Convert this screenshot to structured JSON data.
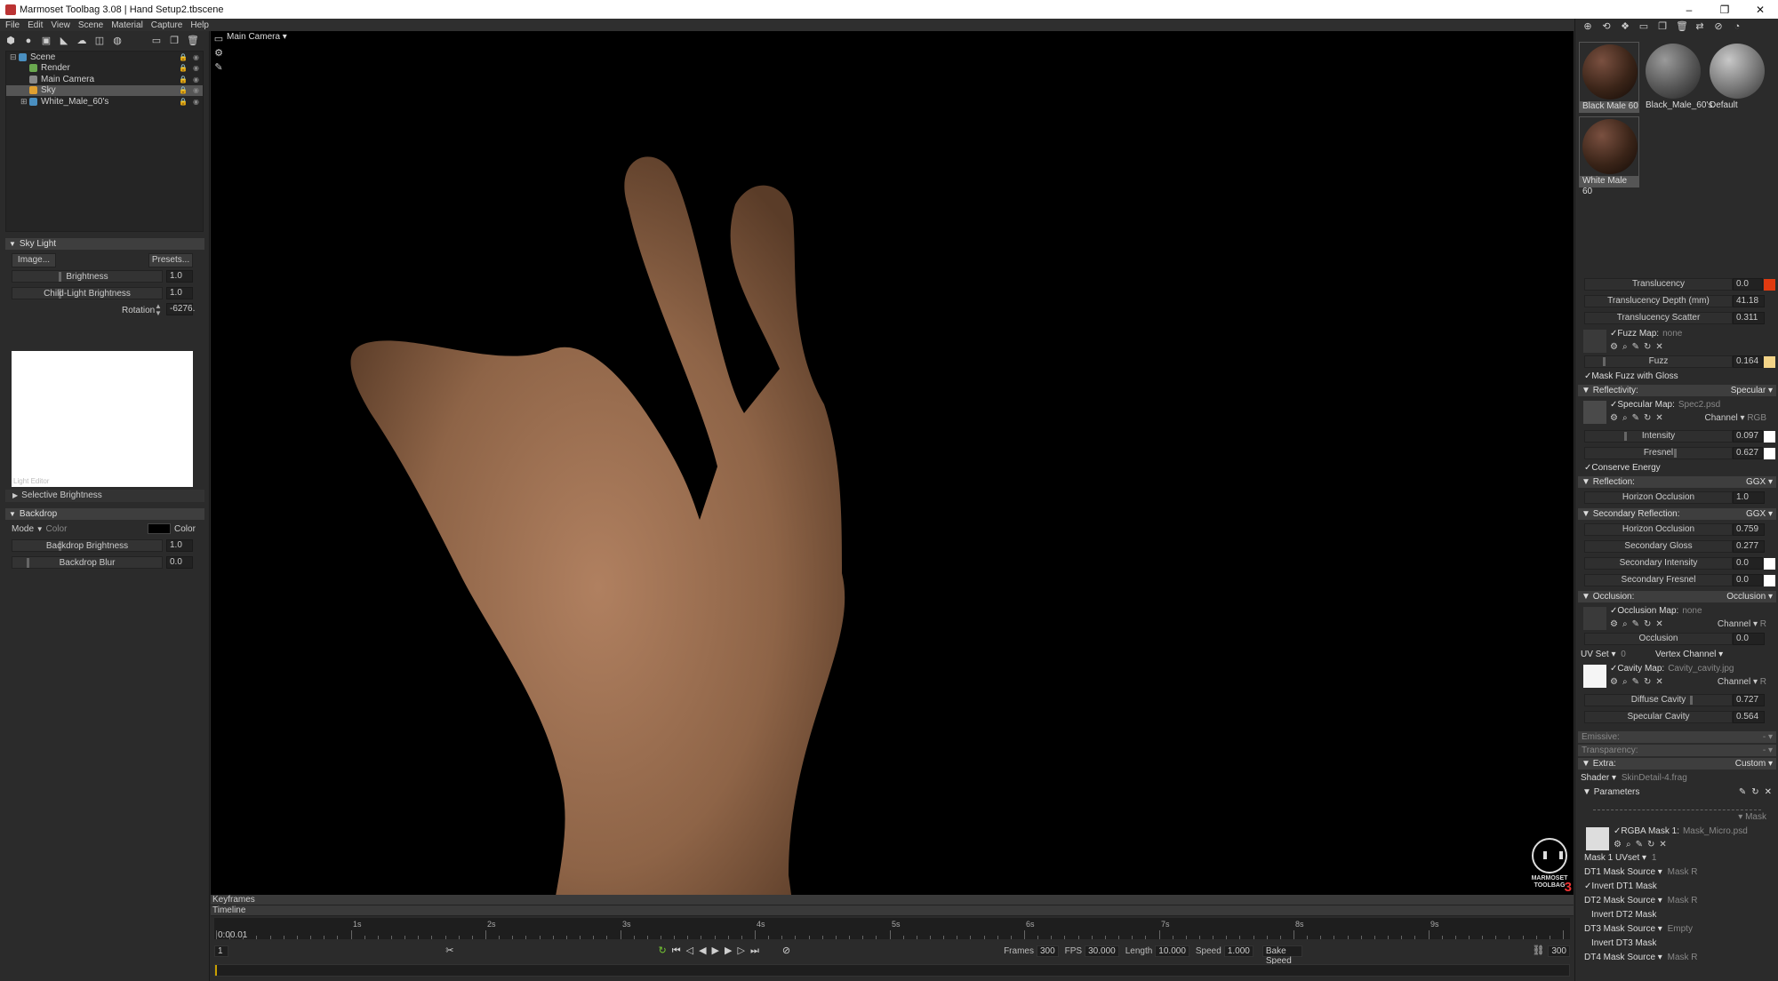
{
  "window": {
    "title": "Marmoset Toolbag 3.08  |  Hand Setup2.tbscene",
    "controls": [
      "–",
      "❐",
      "✕"
    ]
  },
  "menu": [
    "File",
    "Edit",
    "View",
    "Scene",
    "Material",
    "Capture",
    "Help"
  ],
  "scene_tree": [
    {
      "label": "Scene",
      "toggle": "⊟",
      "selected": false,
      "icon_color": "#4a8fc0"
    },
    {
      "label": "Render",
      "toggle": "",
      "selected": false,
      "icon_color": "#6aa84f"
    },
    {
      "label": "Main Camera",
      "toggle": "",
      "selected": false,
      "icon_color": "#888888"
    },
    {
      "label": "Sky",
      "toggle": "",
      "selected": true,
      "icon_color": "#e0a030"
    },
    {
      "label": "White_Male_60's",
      "toggle": "⊞",
      "selected": false,
      "icon_color": "#4a8fc0"
    }
  ],
  "sky_light": {
    "header": "Sky Light",
    "image_button": "Image...",
    "presets_button": "Presets...",
    "brightness_label": "Brightness",
    "brightness_value": "1.0",
    "child_label": "Child-Light Brightness",
    "child_value": "1.0",
    "rotation_label": "Rotation",
    "rotation_value": "-6276.",
    "editor_label": "Light Editor",
    "selective": "Selective Brightness"
  },
  "backdrop": {
    "header": "Backdrop",
    "mode_label": "Mode",
    "mode_value": "Color",
    "color_label": "Color",
    "color_swatch": "#000000",
    "bright_label": "Backdrop Brightness",
    "bright_value": "1.0",
    "blur_label": "Backdrop Blur",
    "blur_value": "0.0"
  },
  "viewport": {
    "camera": "Main Camera",
    "logo_line1": "MARMOSET",
    "logo_line2": "TOOLBAG",
    "logo_version": "3"
  },
  "timeline": {
    "keyframes_label": "Keyframes",
    "timeline_label": "Timeline",
    "ticks": [
      "1s",
      "2s",
      "3s",
      "4s",
      "5s",
      "6s",
      "7s",
      "8s",
      "9s"
    ],
    "current_time": "0:00.01",
    "frame_start": "1",
    "frames_label": "Frames",
    "frames_value": "300",
    "fps_label": "FPS",
    "fps_value": "30.000",
    "length_label": "Length",
    "length_value": "10.000",
    "speed_label": "Speed",
    "speed_value": "1.000",
    "bake_label": "Bake Speed",
    "frame_end": "300"
  },
  "materials": [
    {
      "label": "Black Male 60",
      "selected": true,
      "ball": "dark-skin"
    },
    {
      "label": "Black_Male_60's",
      "selected": false,
      "ball": "grey"
    },
    {
      "label": "Default",
      "selected": false,
      "ball": "grey-light"
    },
    {
      "label": "White Male 60",
      "selected": true,
      "ball": "dark-skin"
    }
  ],
  "props": {
    "translucency": {
      "label": "Translucency",
      "value": "0.0",
      "color": "#e03a10"
    },
    "trans_depth": {
      "label": "Translucency Depth (mm)",
      "value": "41.18"
    },
    "trans_scatter": {
      "label": "Translucency Scatter",
      "value": "0.311"
    },
    "fuzz_map": {
      "label": "Fuzz Map:",
      "value": "none"
    },
    "fuzz": {
      "label": "Fuzz",
      "value": "0.164",
      "color": "#f3d488"
    },
    "mask_fuzz": "Mask Fuzz with Gloss",
    "reflectivity": {
      "label": "Reflectivity:",
      "mode": "Specular"
    },
    "spec_map": {
      "label": "Specular Map:",
      "value": "Spec2.psd",
      "channel_label": "Channel",
      "channel": "RGB"
    },
    "intensity": {
      "label": "Intensity",
      "value": "0.097",
      "color": "#ffffff"
    },
    "fresnel": {
      "label": "Fresnel",
      "value": "0.627",
      "color": "#ffffff"
    },
    "conserve": "Conserve Energy",
    "reflection": {
      "label": "Reflection:",
      "mode": "GGX"
    },
    "horizon1": {
      "label": "Horizon Occlusion",
      "value": "1.0"
    },
    "secondary": {
      "label": "Secondary Reflection:",
      "mode": "GGX"
    },
    "horizon2": {
      "label": "Horizon Occlusion",
      "value": "0.759"
    },
    "sec_gloss": {
      "label": "Secondary Gloss",
      "value": "0.277"
    },
    "sec_intensity": {
      "label": "Secondary Intensity",
      "value": "0.0",
      "color": "#ffffff"
    },
    "sec_fresnel": {
      "label": "Secondary Fresnel",
      "value": "0.0",
      "color": "#ffffff"
    },
    "occlusion_hdr": {
      "label": "Occlusion:",
      "mode": "Occlusion"
    },
    "occ_map": {
      "label": "Occlusion Map:",
      "value": "none",
      "channel_label": "Channel",
      "channel": "R"
    },
    "occlusion": {
      "label": "Occlusion",
      "value": "0.0"
    },
    "uvset": {
      "label": "UV Set",
      "value": "0",
      "vertex": "Vertex Channel"
    },
    "cavity_map": {
      "label": "Cavity Map:",
      "value": "Cavity_cavity.jpg",
      "channel_label": "Channel",
      "channel": "R"
    },
    "diff_cavity": {
      "label": "Diffuse Cavity",
      "value": "0.727"
    },
    "spec_cavity": {
      "label": "Specular Cavity",
      "value": "0.564"
    },
    "emissive": {
      "label": "Emissive:",
      "mode": "-"
    },
    "transparency": {
      "label": "Transparency:",
      "mode": "-"
    },
    "extra": {
      "label": "Extra:",
      "mode": "Custom"
    },
    "shader": {
      "label": "Shader",
      "value": "SkinDetail-4.frag"
    },
    "parameters": "Parameters",
    "mask_dd": "Mask",
    "rgba_mask": {
      "label": "RGBA Mask 1:",
      "value": "Mask_Micro.psd"
    },
    "mask_uv": {
      "label": "Mask 1 UVset",
      "value": "1"
    },
    "dt1": {
      "label": "DT1 Mask Source",
      "value": "Mask R"
    },
    "inv1": "Invert DT1 Mask",
    "dt2": {
      "label": "DT2 Mask Source",
      "value": "Mask R"
    },
    "inv2": "Invert DT2 Mask",
    "dt3": {
      "label": "DT3 Mask Source",
      "value": "Empty"
    },
    "inv3": "Invert DT3 Mask",
    "dt4": {
      "label": "DT4 Mask Source",
      "value": "Mask R"
    }
  }
}
